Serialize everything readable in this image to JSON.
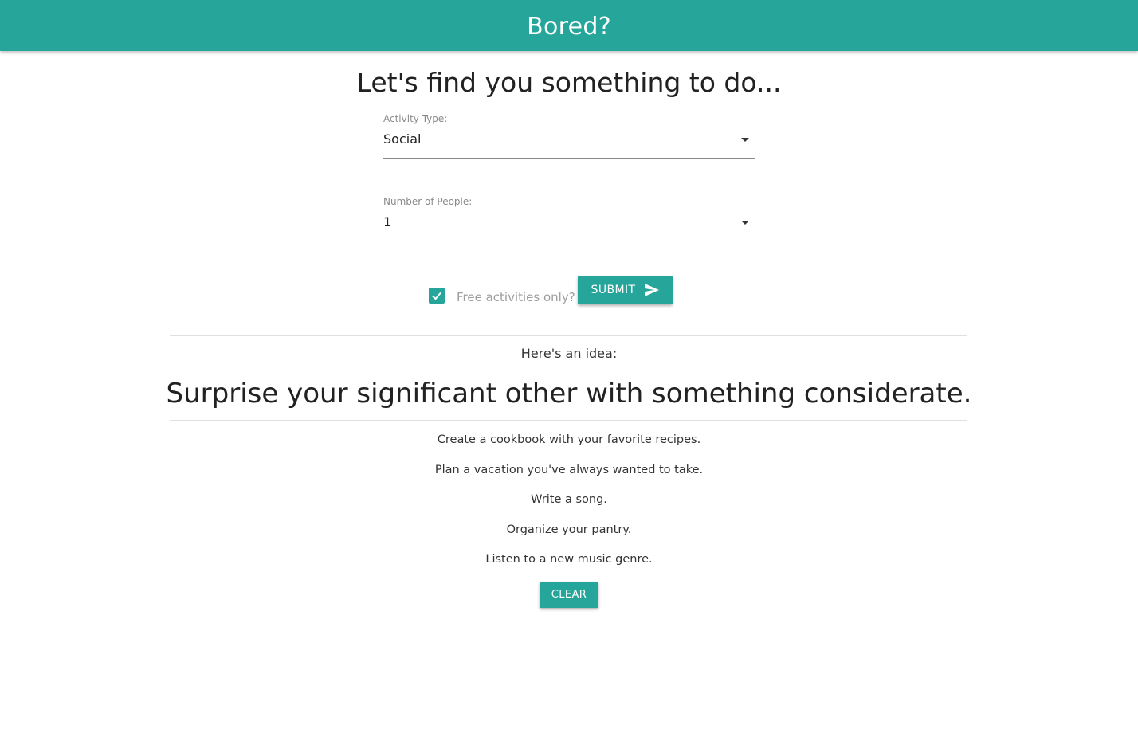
{
  "header": {
    "title": "Bored?"
  },
  "main": {
    "heading": "Let's find you something to do...",
    "activity_type": {
      "label": "Activity Type:",
      "value": "Social"
    },
    "participants": {
      "label": "Number of People:",
      "value": "1"
    },
    "free_only": {
      "label": "Free activities only?",
      "checked": true
    },
    "submit_label": "Submit"
  },
  "result": {
    "label": "Here's an idea:",
    "idea": "Surprise your significant other with something considerate."
  },
  "history": [
    "Create a cookbook with your favorite recipes.",
    "Plan a vacation you've always wanted to take.",
    "Write a song.",
    "Organize your pantry.",
    "Listen to a new music genre."
  ],
  "clear_label": "Clear",
  "colors": {
    "accent": "#26a69a"
  },
  "icons": {
    "select_caret": "arrow-drop-down-icon",
    "checkbox": "check-icon",
    "submit": "send-icon"
  }
}
